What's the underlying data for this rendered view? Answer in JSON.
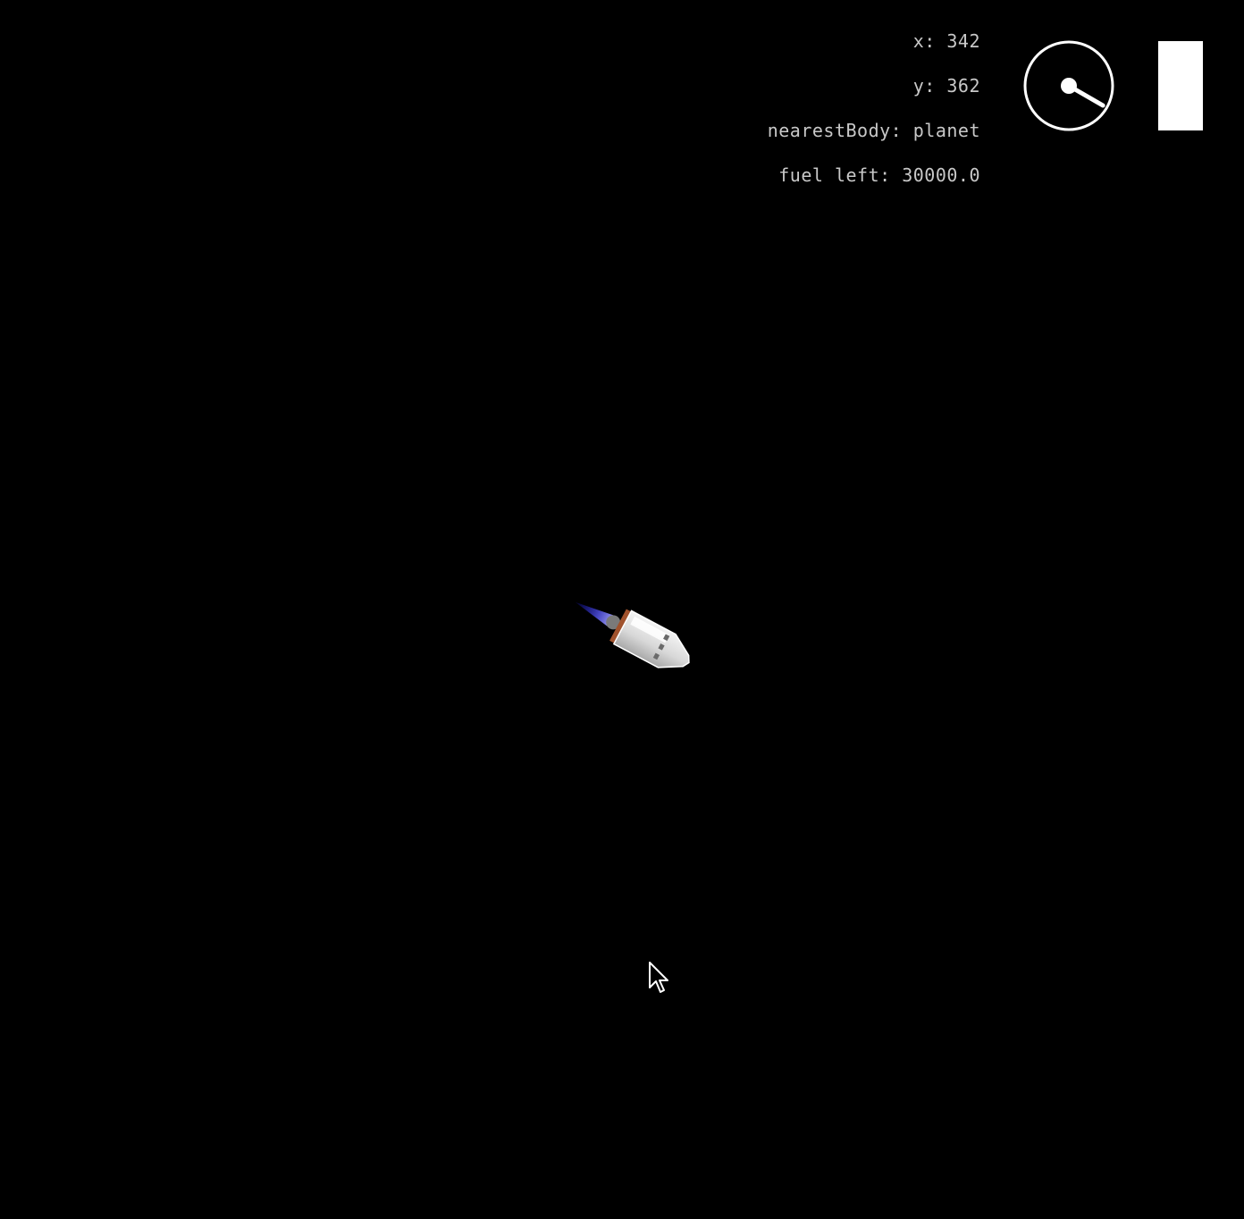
{
  "hud": {
    "x_label": "x:",
    "x_value": "342",
    "y_label": "y:",
    "y_value": "362",
    "nearest_label": "nearestBody:",
    "nearest_value": "planet",
    "fuel_label": "fuel left:",
    "fuel_value": "30000.0"
  },
  "compass": {
    "icon": "compass-dial-icon",
    "heading_deg": 120
  },
  "fuel_gauge": {
    "fill_fraction": 1.0,
    "color": "#ffffff"
  },
  "ship": {
    "icon": "rocket-ship-icon",
    "thrust_color": "#3a3aff"
  },
  "colors": {
    "background": "#000000",
    "hud_text": "#c8c8c8",
    "foreground": "#ffffff"
  }
}
